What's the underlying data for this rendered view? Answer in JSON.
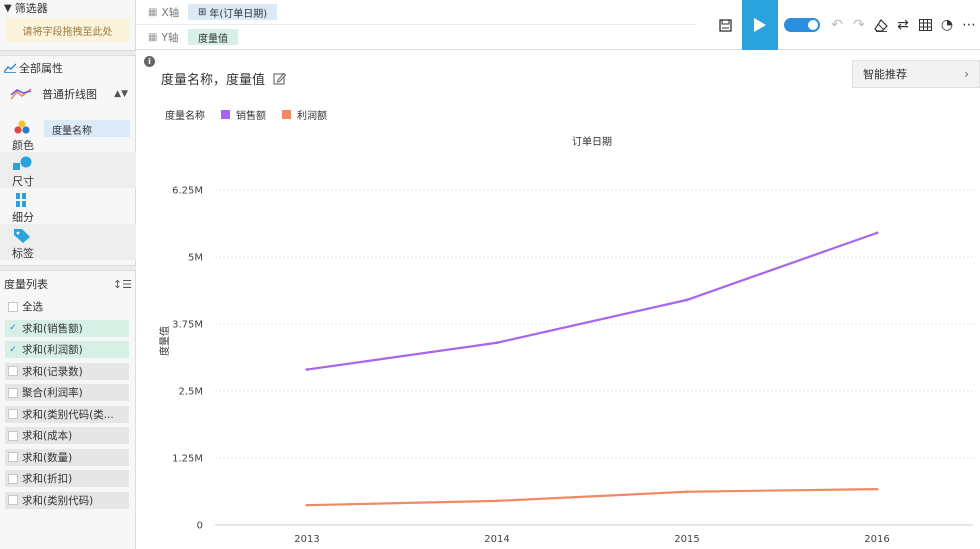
{
  "filter": {
    "title": "筛选器",
    "drop_hint": "请将字段拖拽至此处"
  },
  "properties": {
    "title": "全部属性",
    "chart_type": "普通折线图"
  },
  "marks": {
    "color_label": "颜色",
    "color_field": "度量名称",
    "size_label": "尺寸",
    "detail_label": "细分",
    "tag_label": "标签"
  },
  "measures": {
    "title": "度量列表",
    "items": [
      {
        "label": "全选",
        "checked": false
      },
      {
        "label": "求和(销售额)",
        "checked": true
      },
      {
        "label": "求和(利润额)",
        "checked": true
      },
      {
        "label": "求和(记录数)",
        "checked": false
      },
      {
        "label": "聚合(利润率)",
        "checked": false
      },
      {
        "label": "求和(类别代码(类...",
        "checked": false
      },
      {
        "label": "求和(成本)",
        "checked": false
      },
      {
        "label": "求和(数量)",
        "checked": false
      },
      {
        "label": "求和(折扣)",
        "checked": false
      },
      {
        "label": "求和(类别代码)",
        "checked": false
      }
    ]
  },
  "axes": {
    "x_label": "X轴",
    "x_field": "年(订单日期)",
    "y_label": "Y轴",
    "y_field": "度量值"
  },
  "toolbar": {
    "accent": "#2aa3dc",
    "toggle_color": "#2b8fe0"
  },
  "canvas": {
    "title": "度量名称，度量值",
    "smart_recommend": "智能推荐"
  },
  "chart_data": {
    "type": "line",
    "title": "订单日期",
    "xlabel": "",
    "ylabel": "度量值",
    "legend_title": "度量名称",
    "categories": [
      "2013",
      "2014",
      "2015",
      "2016"
    ],
    "ylim": [
      0,
      6250000
    ],
    "yticks": [
      0,
      1250000,
      2500000,
      3750000,
      5000000,
      6250000
    ],
    "ytick_labels": [
      "0",
      "1.25M",
      "2.5M",
      "3.75M",
      "5M",
      "6.25M"
    ],
    "grid": true,
    "legend_position": "top-left",
    "series": [
      {
        "name": "销售额",
        "color": "#a865f0",
        "values": [
          2900000,
          3400000,
          4200000,
          5450000
        ]
      },
      {
        "name": "利润额",
        "color": "#f08a65",
        "values": [
          370000,
          450000,
          620000,
          670000
        ]
      }
    ]
  }
}
